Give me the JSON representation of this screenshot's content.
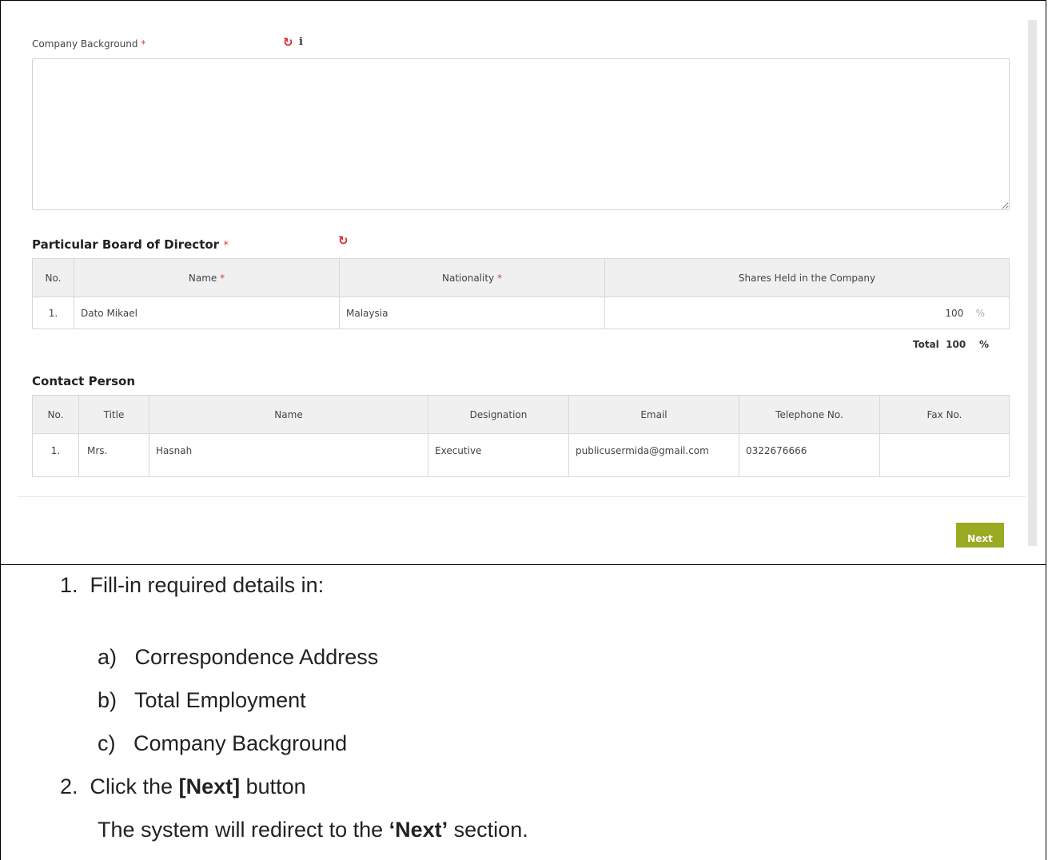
{
  "company_background": {
    "label": "Company Background",
    "required_mark": "*",
    "refresh_icon": "refresh-icon",
    "info_icon": "info-icon",
    "value": ""
  },
  "board": {
    "title": "Particular Board of Director",
    "required_mark": "*",
    "refresh_icon": "refresh-icon",
    "headers": [
      "No.",
      "Name",
      "Nationality",
      "Shares Held in the Company"
    ],
    "header_required": [
      "",
      "*",
      "*",
      ""
    ],
    "rows": [
      {
        "no": "1.",
        "name": "Dato Mikael",
        "nationality": "Malaysia",
        "shares": "100",
        "unit": "%"
      }
    ],
    "total_label": "Total",
    "total_value": "100",
    "total_unit": "%"
  },
  "contact": {
    "title": "Contact Person",
    "headers": [
      "No.",
      "Title",
      "Name",
      "Designation",
      "Email",
      "Telephone No.",
      "Fax No."
    ],
    "rows": [
      {
        "no": "1.",
        "title": "Mrs.",
        "name": "Hasnah",
        "designation": "Executive",
        "email": "publicusermida@gmail.com",
        "telephone": "0322676666",
        "fax": ""
      }
    ]
  },
  "next_button": "Next",
  "instructions": {
    "step1": "Fill-in required details in:",
    "step1_num": "1.",
    "items": [
      {
        "mark": "a)",
        "text": "Correspondence Address"
      },
      {
        "mark": "b)",
        "text": "Total Employment"
      },
      {
        "mark": "c)",
        "text": "Company Background"
      }
    ],
    "step2_num": "2.",
    "step2_pre": "Click the ",
    "step2_bold": "[Next]",
    "step2_post": " button",
    "step2_line2_pre": "The system will redirect to the ",
    "step2_line2_bold": "‘Next’",
    "step2_line2_post": " section."
  }
}
